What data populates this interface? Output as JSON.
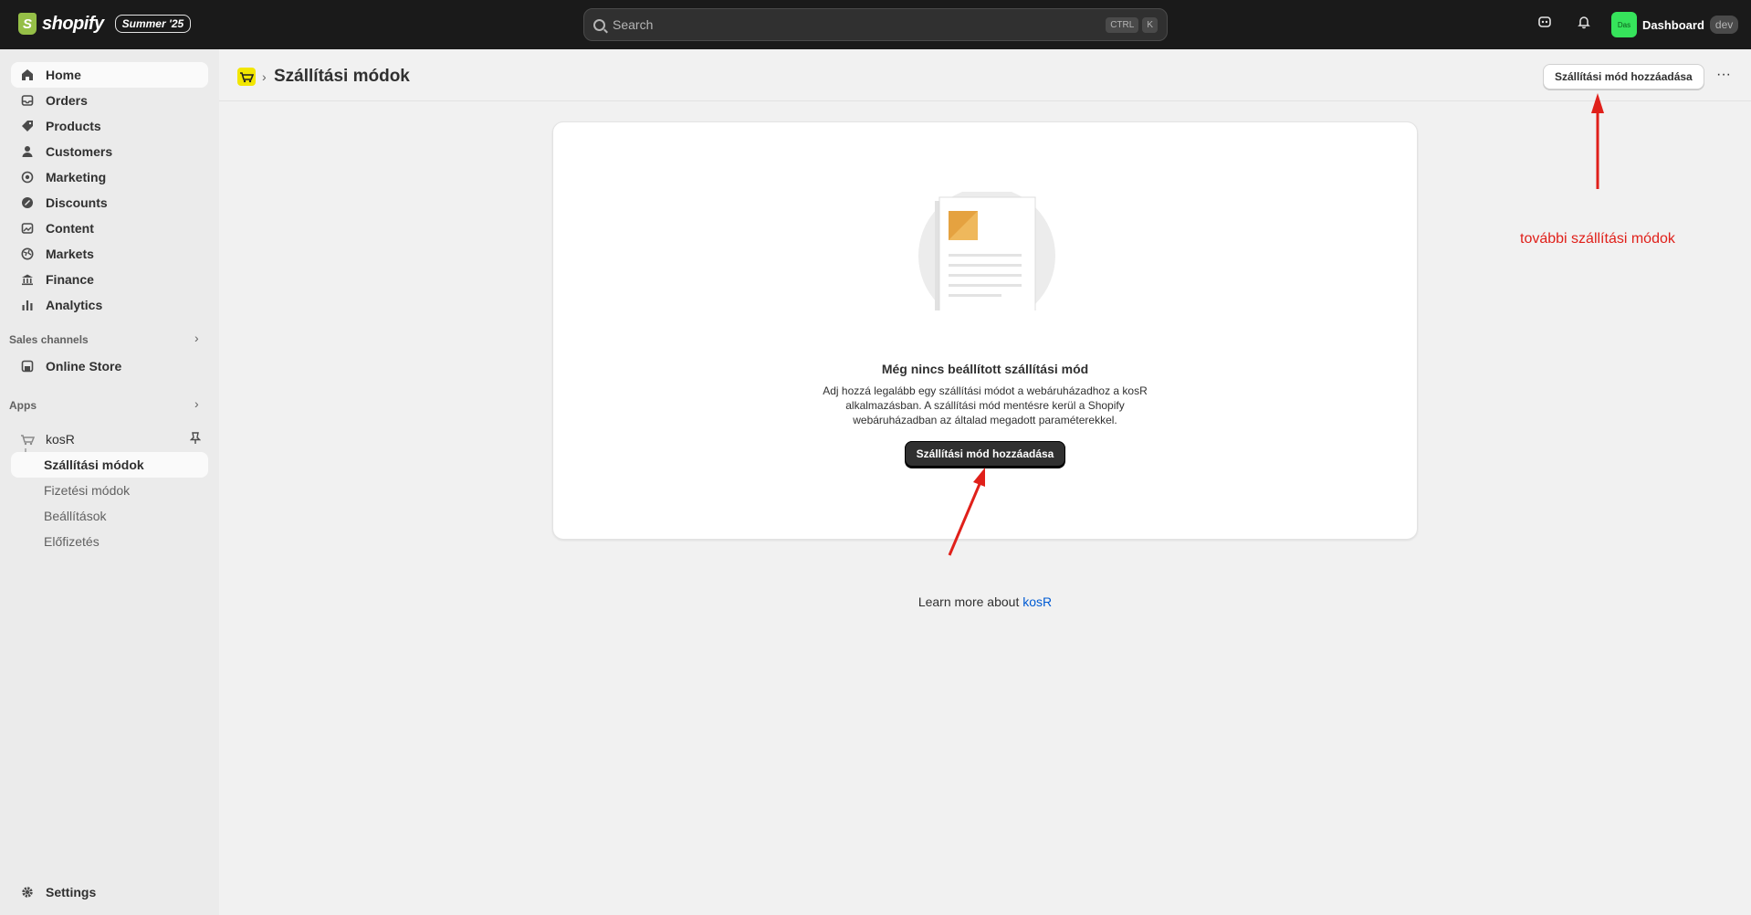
{
  "topbar": {
    "logo_text": "shopify",
    "edition_badge": "Summer '25",
    "search_placeholder": "Search",
    "shortcut_ctrl": "CTRL",
    "shortcut_key": "K",
    "store_avatar": "Das",
    "store_name": "Dashboard",
    "store_badge": "dev"
  },
  "sidebar": {
    "items": [
      {
        "label": "Home",
        "icon": "home-icon"
      },
      {
        "label": "Orders",
        "icon": "inbox-icon"
      },
      {
        "label": "Products",
        "icon": "tag-icon"
      },
      {
        "label": "Customers",
        "icon": "person-icon"
      },
      {
        "label": "Marketing",
        "icon": "target-icon"
      },
      {
        "label": "Discounts",
        "icon": "discount-icon"
      },
      {
        "label": "Content",
        "icon": "image-icon"
      },
      {
        "label": "Markets",
        "icon": "globe-icon"
      },
      {
        "label": "Finance",
        "icon": "bank-icon"
      },
      {
        "label": "Analytics",
        "icon": "chart-icon"
      }
    ],
    "sales_channels_label": "Sales channels",
    "online_store": "Online Store",
    "apps_label": "Apps",
    "app_name": "kosR",
    "app_subitems": [
      "Szállítási módok",
      "Fizetési módok",
      "Beállítások",
      "Előfizetés"
    ],
    "settings": "Settings"
  },
  "main": {
    "page_title": "Szállítási módok",
    "header_button": "Szállítási mód hozzáadása",
    "empty_title": "Még nincs beállított szállítási mód",
    "empty_desc": "Adj hozzá legalább egy szállítási módot a webáruházadhoz a kosR alkalmazásban. A szállítási mód mentésre kerül a Shopify webáruházadban az általad megadott paraméterekkel.",
    "primary_button": "Szállítási mód hozzáadása",
    "learn_more_prefix": "Learn more about",
    "learn_more_link": "kosR"
  },
  "annotation": {
    "text": "további szállítási módok",
    "color": "#e0201a"
  }
}
